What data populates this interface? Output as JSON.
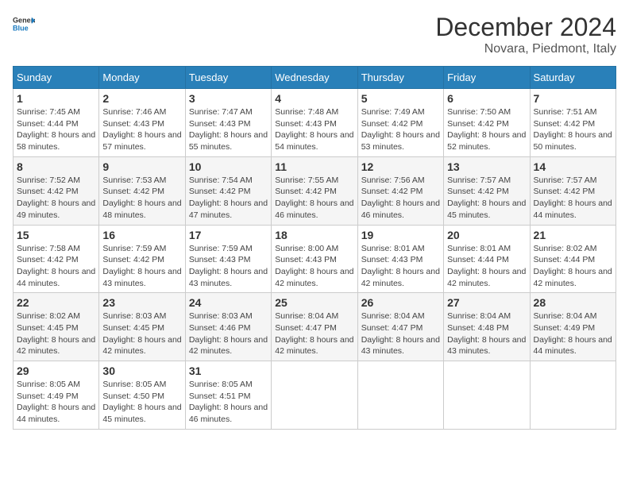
{
  "logo": {
    "general": "General",
    "blue": "Blue"
  },
  "title": "December 2024",
  "location": "Novara, Piedmont, Italy",
  "days_of_week": [
    "Sunday",
    "Monday",
    "Tuesday",
    "Wednesday",
    "Thursday",
    "Friday",
    "Saturday"
  ],
  "weeks": [
    [
      {
        "day": "1",
        "sunrise": "7:45 AM",
        "sunset": "4:44 PM",
        "daylight": "8 hours and 58 minutes."
      },
      {
        "day": "2",
        "sunrise": "7:46 AM",
        "sunset": "4:43 PM",
        "daylight": "8 hours and 57 minutes."
      },
      {
        "day": "3",
        "sunrise": "7:47 AM",
        "sunset": "4:43 PM",
        "daylight": "8 hours and 55 minutes."
      },
      {
        "day": "4",
        "sunrise": "7:48 AM",
        "sunset": "4:43 PM",
        "daylight": "8 hours and 54 minutes."
      },
      {
        "day": "5",
        "sunrise": "7:49 AM",
        "sunset": "4:42 PM",
        "daylight": "8 hours and 53 minutes."
      },
      {
        "day": "6",
        "sunrise": "7:50 AM",
        "sunset": "4:42 PM",
        "daylight": "8 hours and 52 minutes."
      },
      {
        "day": "7",
        "sunrise": "7:51 AM",
        "sunset": "4:42 PM",
        "daylight": "8 hours and 50 minutes."
      }
    ],
    [
      {
        "day": "8",
        "sunrise": "7:52 AM",
        "sunset": "4:42 PM",
        "daylight": "8 hours and 49 minutes."
      },
      {
        "day": "9",
        "sunrise": "7:53 AM",
        "sunset": "4:42 PM",
        "daylight": "8 hours and 48 minutes."
      },
      {
        "day": "10",
        "sunrise": "7:54 AM",
        "sunset": "4:42 PM",
        "daylight": "8 hours and 47 minutes."
      },
      {
        "day": "11",
        "sunrise": "7:55 AM",
        "sunset": "4:42 PM",
        "daylight": "8 hours and 46 minutes."
      },
      {
        "day": "12",
        "sunrise": "7:56 AM",
        "sunset": "4:42 PM",
        "daylight": "8 hours and 46 minutes."
      },
      {
        "day": "13",
        "sunrise": "7:57 AM",
        "sunset": "4:42 PM",
        "daylight": "8 hours and 45 minutes."
      },
      {
        "day": "14",
        "sunrise": "7:57 AM",
        "sunset": "4:42 PM",
        "daylight": "8 hours and 44 minutes."
      }
    ],
    [
      {
        "day": "15",
        "sunrise": "7:58 AM",
        "sunset": "4:42 PM",
        "daylight": "8 hours and 44 minutes."
      },
      {
        "day": "16",
        "sunrise": "7:59 AM",
        "sunset": "4:42 PM",
        "daylight": "8 hours and 43 minutes."
      },
      {
        "day": "17",
        "sunrise": "7:59 AM",
        "sunset": "4:43 PM",
        "daylight": "8 hours and 43 minutes."
      },
      {
        "day": "18",
        "sunrise": "8:00 AM",
        "sunset": "4:43 PM",
        "daylight": "8 hours and 42 minutes."
      },
      {
        "day": "19",
        "sunrise": "8:01 AM",
        "sunset": "4:43 PM",
        "daylight": "8 hours and 42 minutes."
      },
      {
        "day": "20",
        "sunrise": "8:01 AM",
        "sunset": "4:44 PM",
        "daylight": "8 hours and 42 minutes."
      },
      {
        "day": "21",
        "sunrise": "8:02 AM",
        "sunset": "4:44 PM",
        "daylight": "8 hours and 42 minutes."
      }
    ],
    [
      {
        "day": "22",
        "sunrise": "8:02 AM",
        "sunset": "4:45 PM",
        "daylight": "8 hours and 42 minutes."
      },
      {
        "day": "23",
        "sunrise": "8:03 AM",
        "sunset": "4:45 PM",
        "daylight": "8 hours and 42 minutes."
      },
      {
        "day": "24",
        "sunrise": "8:03 AM",
        "sunset": "4:46 PM",
        "daylight": "8 hours and 42 minutes."
      },
      {
        "day": "25",
        "sunrise": "8:04 AM",
        "sunset": "4:47 PM",
        "daylight": "8 hours and 42 minutes."
      },
      {
        "day": "26",
        "sunrise": "8:04 AM",
        "sunset": "4:47 PM",
        "daylight": "8 hours and 43 minutes."
      },
      {
        "day": "27",
        "sunrise": "8:04 AM",
        "sunset": "4:48 PM",
        "daylight": "8 hours and 43 minutes."
      },
      {
        "day": "28",
        "sunrise": "8:04 AM",
        "sunset": "4:49 PM",
        "daylight": "8 hours and 44 minutes."
      }
    ],
    [
      {
        "day": "29",
        "sunrise": "8:05 AM",
        "sunset": "4:49 PM",
        "daylight": "8 hours and 44 minutes."
      },
      {
        "day": "30",
        "sunrise": "8:05 AM",
        "sunset": "4:50 PM",
        "daylight": "8 hours and 45 minutes."
      },
      {
        "day": "31",
        "sunrise": "8:05 AM",
        "sunset": "4:51 PM",
        "daylight": "8 hours and 46 minutes."
      },
      null,
      null,
      null,
      null
    ]
  ],
  "labels": {
    "sunrise": "Sunrise:",
    "sunset": "Sunset:",
    "daylight": "Daylight:"
  }
}
